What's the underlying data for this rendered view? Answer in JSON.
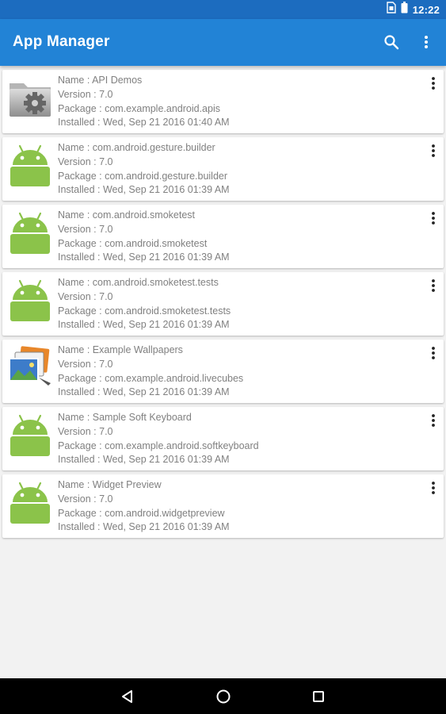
{
  "status_bar": {
    "time": "12:22"
  },
  "app_bar": {
    "title": "App Manager"
  },
  "colors": {
    "status_bar": "#1c6cbf",
    "app_bar": "#2283d6",
    "android_green": "#8bc34a",
    "text_gray": "#808080"
  },
  "apps": [
    {
      "icon": "settings-folder-icon",
      "name_label": "Name : ",
      "name": "API Demos",
      "version_label": "Version : ",
      "version": "7.0",
      "package_label": "Package : ",
      "package": "com.example.android.apis",
      "installed_label": "Installed : ",
      "installed": "Wed, Sep 21 2016 01:40 AM"
    },
    {
      "icon": "android-robot-icon",
      "name_label": "Name : ",
      "name": "com.android.gesture.builder",
      "version_label": "Version : ",
      "version": "7.0",
      "package_label": "Package : ",
      "package": "com.android.gesture.builder",
      "installed_label": "Installed : ",
      "installed": "Wed, Sep 21 2016 01:39 AM"
    },
    {
      "icon": "android-robot-icon",
      "name_label": "Name : ",
      "name": "com.android.smoketest",
      "version_label": "Version : ",
      "version": "7.0",
      "package_label": "Package : ",
      "package": "com.android.smoketest",
      "installed_label": "Installed : ",
      "installed": "Wed, Sep 21 2016 01:39 AM"
    },
    {
      "icon": "android-robot-icon",
      "name_label": "Name : ",
      "name": "com.android.smoketest.tests",
      "version_label": "Version : ",
      "version": "7.0",
      "package_label": "Package : ",
      "package": "com.android.smoketest.tests",
      "installed_label": "Installed : ",
      "installed": "Wed, Sep 21 2016 01:39 AM"
    },
    {
      "icon": "wallpapers-icon",
      "name_label": "Name : ",
      "name": "Example Wallpapers",
      "version_label": "Version : ",
      "version": "7.0",
      "package_label": "Package : ",
      "package": "com.example.android.livecubes",
      "installed_label": "Installed : ",
      "installed": "Wed, Sep 21 2016 01:39 AM"
    },
    {
      "icon": "android-robot-icon",
      "name_label": "Name : ",
      "name": "Sample Soft Keyboard",
      "version_label": "Version : ",
      "version": "7.0",
      "package_label": "Package : ",
      "package": "com.example.android.softkeyboard",
      "installed_label": "Installed : ",
      "installed": "Wed, Sep 21 2016 01:39 AM"
    },
    {
      "icon": "android-robot-icon",
      "name_label": "Name : ",
      "name": "Widget Preview",
      "version_label": "Version : ",
      "version": "7.0",
      "package_label": "Package : ",
      "package": "com.android.widgetpreview",
      "installed_label": "Installed : ",
      "installed": "Wed, Sep 21 2016 01:39 AM"
    }
  ]
}
